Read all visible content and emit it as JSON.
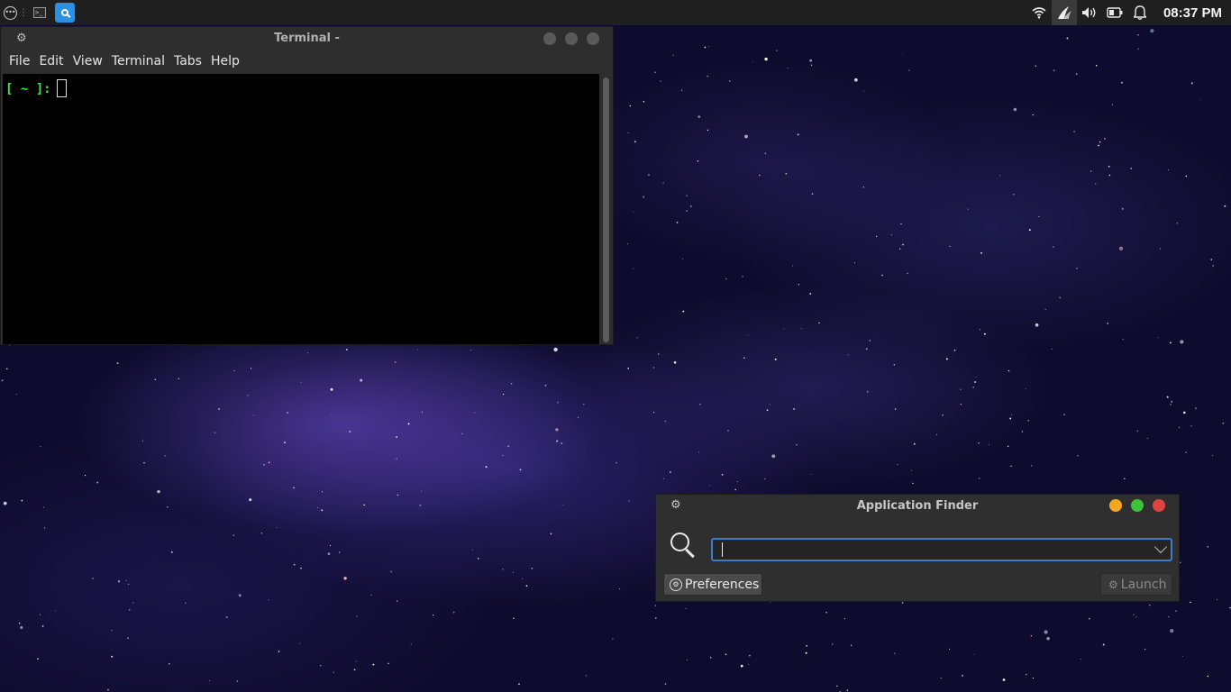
{
  "taskbar": {
    "clock": "08:37 PM",
    "tasks": [
      "terminal",
      "application-finder"
    ],
    "tray_icons": [
      "wifi-icon",
      "app-tray-icon",
      "volume-icon",
      "battery-icon",
      "notification-bell-icon"
    ]
  },
  "terminal": {
    "title": "Terminal -",
    "menu": [
      "File",
      "Edit",
      "View",
      "Terminal",
      "Tabs",
      "Help"
    ],
    "prompt": "[ ~ ]:",
    "prompt_color": "#3ee64a",
    "background": "#000000"
  },
  "appfinder": {
    "title": "Application Finder",
    "search_value": "",
    "preferences_label": "Preferences",
    "launch_label": "Launch",
    "accent": "#3a7dc9",
    "buttons": {
      "minimize": "#f5a623",
      "maximize": "#3cc13b",
      "close": "#e0443e"
    }
  }
}
